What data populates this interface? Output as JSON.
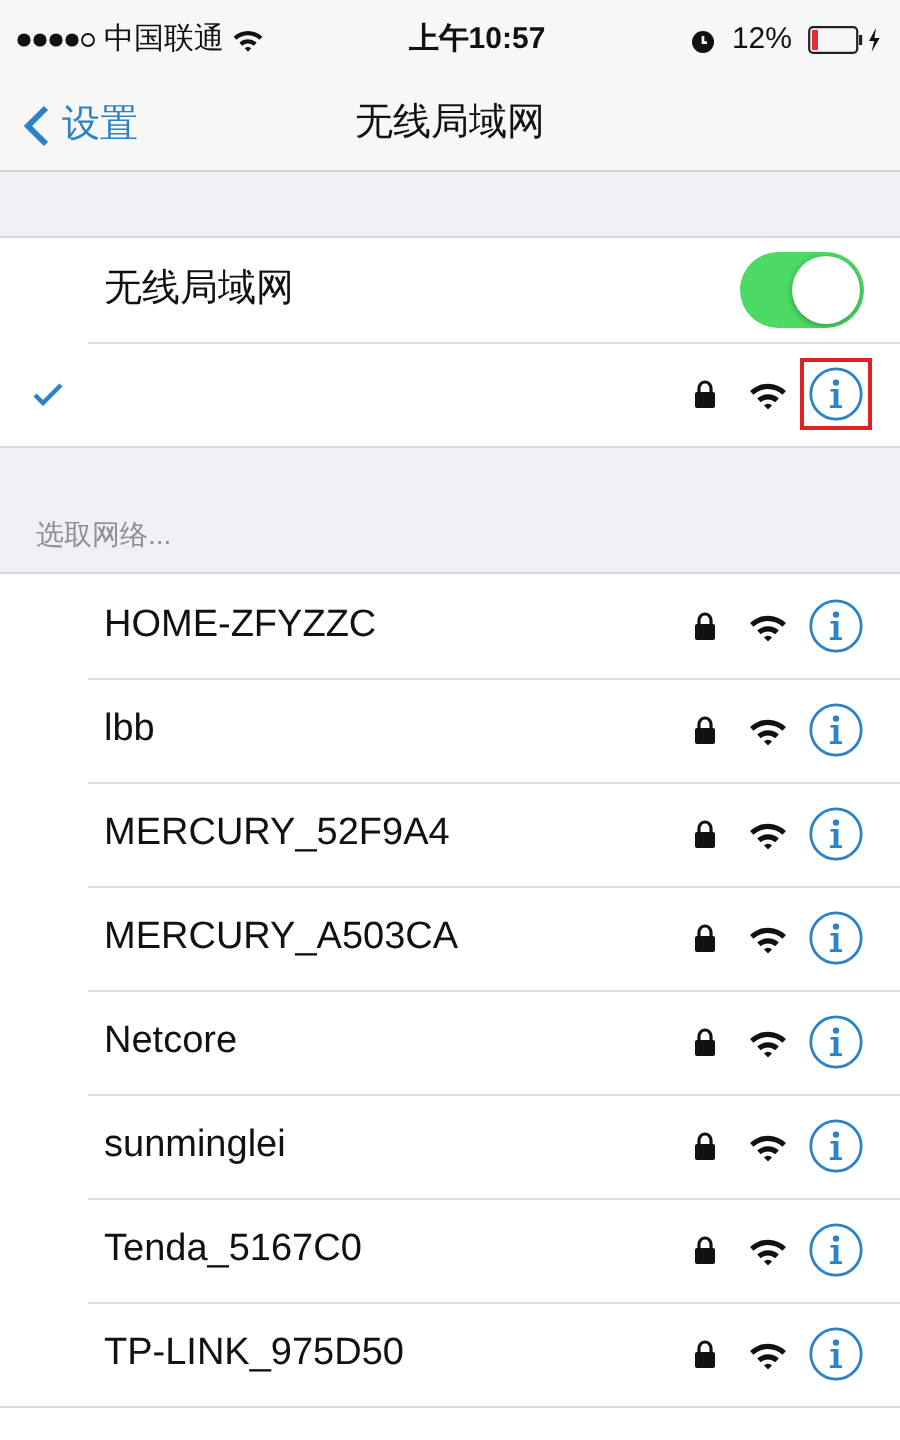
{
  "status_bar": {
    "carrier": "中国联通",
    "time": "上午10:57",
    "battery": "12%"
  },
  "nav": {
    "back": "设置",
    "title": "无线局域网"
  },
  "wifi_switch": {
    "label": "无线局域网",
    "on": true
  },
  "current_network": {
    "checked": true,
    "highlighted": true
  },
  "section_header": "选取网络...",
  "networks": [
    {
      "name": "HOME-ZFYZZC"
    },
    {
      "name": "lbb"
    },
    {
      "name": "MERCURY_52F9A4"
    },
    {
      "name": "MERCURY_A503CA"
    },
    {
      "name": "Netcore"
    },
    {
      "name": "sunminglei"
    },
    {
      "name": "Tenda_5167C0"
    },
    {
      "name": "TP-LINK_975D50"
    }
  ]
}
